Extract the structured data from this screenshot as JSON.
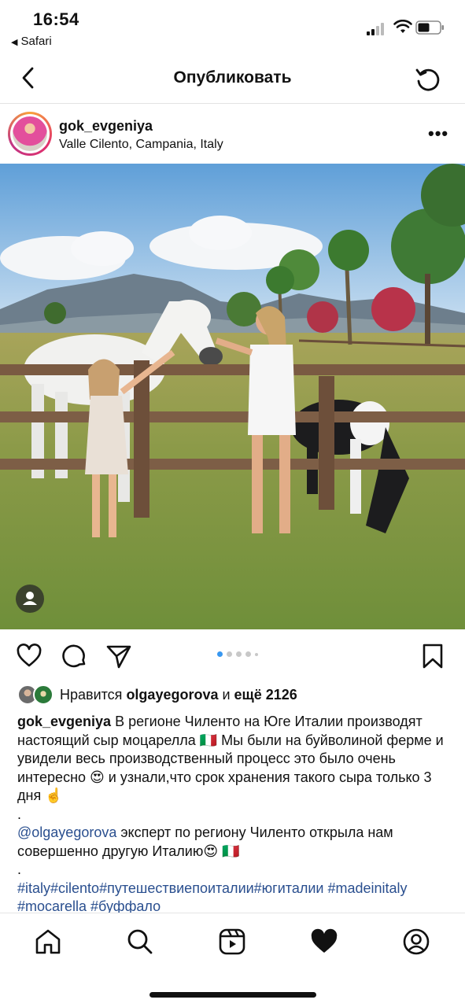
{
  "status_bar": {
    "time": "16:54",
    "back_app": "Safari",
    "back_icon": "back-triangle-icon"
  },
  "nav": {
    "title": "Опубликовать",
    "back_icon": "chevron-left-icon",
    "refresh_icon": "refresh-icon"
  },
  "post": {
    "username": "gok_evgeniya",
    "location": "Valle Cilento, Campania, Italy",
    "more_label": "•••"
  },
  "likes": {
    "prefix": "Нравится ",
    "user": "olgayegorova",
    "middle": " и ",
    "count": "ещё 2126"
  },
  "caption": {
    "username": "gok_evgeniya",
    "text1": " В регионе Чиленто на Юге Италии производят настоящий сыр моцарелла 🇮🇹 Мы были на буйволиной ферме и увидели весь производственный процесс это было очень интересно 😍 и узнали,что срок хранения такого сыра только 3 дня ☝️",
    "dot1": ".",
    "mention": "@olgayegorova",
    "text2": "  эксперт по региону Чиленто открыла нам совершенно другую Италию😍 🇮🇹",
    "dot2": ".",
    "hashtags": "#italy#cilento#путешествиепоиталии#югиталии #madeinitaly #mocarella #буффало"
  },
  "carousel": {
    "count": 5,
    "active_index": 0
  },
  "colors": {
    "accent_blue": "#3897f0",
    "link": "#2a4f8f",
    "text": "#111111"
  },
  "tabbar": {
    "icons": [
      "home-icon",
      "search-icon",
      "reels-icon",
      "heart-filled-icon",
      "profile-icon"
    ]
  }
}
